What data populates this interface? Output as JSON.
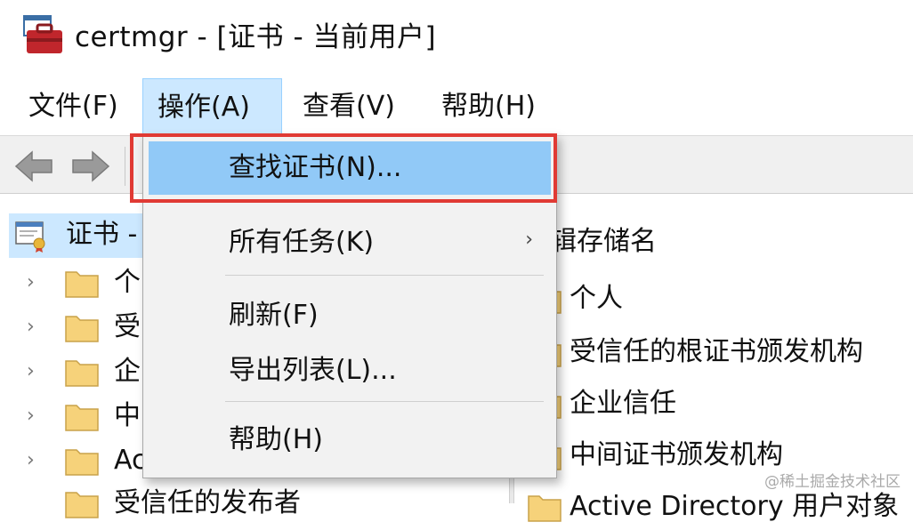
{
  "window": {
    "title": "certmgr - [证书 - 当前用户]"
  },
  "menubar": {
    "items": [
      {
        "label": "文件(F)"
      },
      {
        "label": "操作(A)",
        "active": true
      },
      {
        "label": "查看(V)"
      },
      {
        "label": "帮助(H)"
      }
    ]
  },
  "toolbar": {
    "back_icon": "back-arrow-icon",
    "forward_icon": "forward-arrow-icon"
  },
  "tree": {
    "root_label": "证书 -",
    "items": [
      {
        "label": "个"
      },
      {
        "label": "受"
      },
      {
        "label": "企"
      },
      {
        "label": "中"
      },
      {
        "label": "Ac"
      },
      {
        "label": "受信任的发布者"
      }
    ]
  },
  "list": {
    "header": "辑存储名",
    "items": [
      {
        "label": "个人"
      },
      {
        "label": "受信任的根证书颁发机构"
      },
      {
        "label": "企业信任"
      },
      {
        "label": "中间证书颁发机构"
      },
      {
        "label": "Active Directory 用户对象"
      }
    ]
  },
  "dropdown": {
    "items": [
      {
        "label": "查找证书(N)..."
      },
      {
        "label": "所有任务(K)",
        "submenu_arrow": "›"
      },
      {
        "label": "刷新(F)"
      },
      {
        "label": "导出列表(L)..."
      },
      {
        "label": "帮助(H)"
      }
    ]
  },
  "watermark": "@稀土掘金技术社区",
  "colors": {
    "highlight": "#e03a34",
    "menu_active": "#cce8ff",
    "menu_hover": "#91c9f7"
  }
}
